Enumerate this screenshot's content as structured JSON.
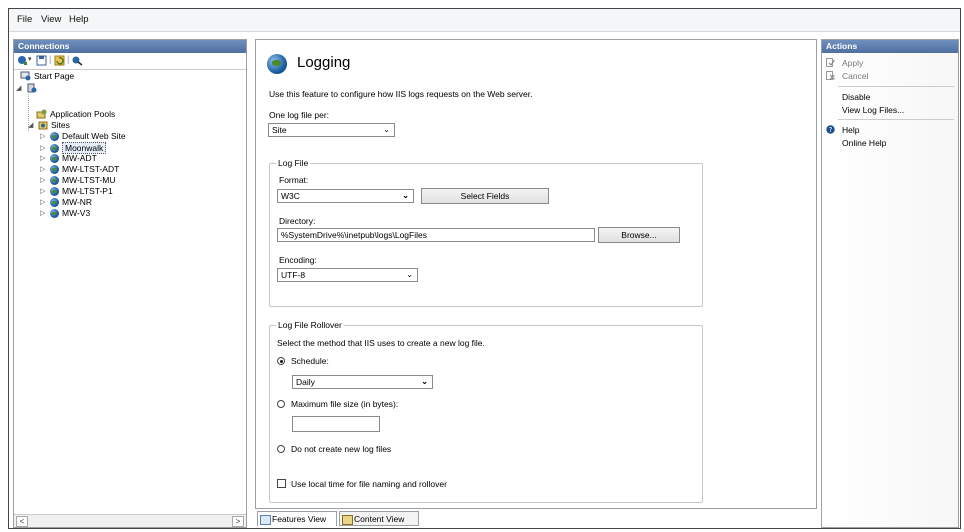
{
  "menu": [
    "File",
    "View",
    "Help"
  ],
  "connections": {
    "header": "Connections",
    "tree": {
      "start_page": "Start Page",
      "app_pools": "Application Pools",
      "sites": "Sites",
      "site_list": [
        "Default Web Site",
        "Moonwalk",
        "MW-ADT",
        "MW-LTST-ADT",
        "MW-LTST-MU",
        "MW-LTST-P1",
        "MW-NR",
        "MW-V3"
      ]
    }
  },
  "main": {
    "title": "Logging",
    "description": "Use this feature to configure how IIS logs requests on the Web server.",
    "one_log_label": "One log file per:",
    "one_log_value": "Site",
    "log_file": {
      "legend": "Log File",
      "format_label": "Format:",
      "format_value": "W3C",
      "select_fields": "Select Fields",
      "directory_label": "Directory:",
      "directory_value": "%SystemDrive%\\inetpub\\logs\\LogFiles",
      "browse": "Browse...",
      "encoding_label": "Encoding:",
      "encoding_value": "UTF-8"
    },
    "rollover": {
      "legend": "Log File Rollover",
      "description": "Select the method that IIS uses to create a new log file.",
      "schedule_label": "Schedule:",
      "schedule_value": "Daily",
      "max_size_label": "Maximum file size (in bytes):",
      "max_size_value": "",
      "no_new_label": "Do not create new log files",
      "local_time_label": "Use local time for file naming and rollover"
    },
    "view_tabs": {
      "features": "Features View",
      "content": "Content View"
    }
  },
  "actions": {
    "header": "Actions",
    "apply": "Apply",
    "cancel": "Cancel",
    "disable": "Disable",
    "view_log_files": "View Log Files...",
    "help": "Help",
    "online_help": "Online Help"
  }
}
